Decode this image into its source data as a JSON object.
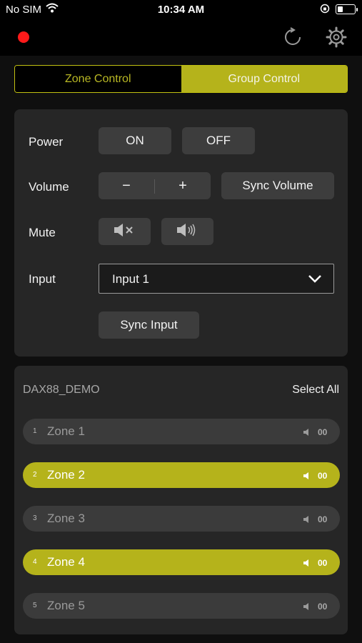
{
  "status_bar": {
    "carrier": "No SIM",
    "time": "10:34 AM",
    "battery_level": 0.25
  },
  "nav": {
    "record_color": "#ff1a1a",
    "icons": [
      "refresh-icon",
      "gear-icon"
    ]
  },
  "segments": {
    "zone_control": "Zone Control",
    "group_control": "Group Control",
    "selected": "Group Control"
  },
  "controls": {
    "power_label": "Power",
    "power_on": "ON",
    "power_off": "OFF",
    "volume_label": "Volume",
    "volume_down": "−",
    "volume_up": "+",
    "sync_volume": "Sync Volume",
    "mute_label": "Mute",
    "mute_icons": [
      "speaker-muted-icon",
      "speaker-volume-icon"
    ],
    "input_label": "Input",
    "input_value": "Input 1",
    "sync_input": "Sync Input"
  },
  "zones_panel": {
    "device": "DAX88_DEMO",
    "select_all": "Select All",
    "zones": [
      {
        "num": "1",
        "name": "Zone 1",
        "volume": "00",
        "selected": false
      },
      {
        "num": "2",
        "name": "Zone 2",
        "volume": "00",
        "selected": true
      },
      {
        "num": "3",
        "name": "Zone 3",
        "volume": "00",
        "selected": false
      },
      {
        "num": "4",
        "name": "Zone 4",
        "volume": "00",
        "selected": true
      },
      {
        "num": "5",
        "name": "Zone 5",
        "volume": "00",
        "selected": false
      }
    ]
  },
  "colors": {
    "accent": "#b5b31b",
    "background": "#0f0f0f",
    "card": "#262626"
  }
}
